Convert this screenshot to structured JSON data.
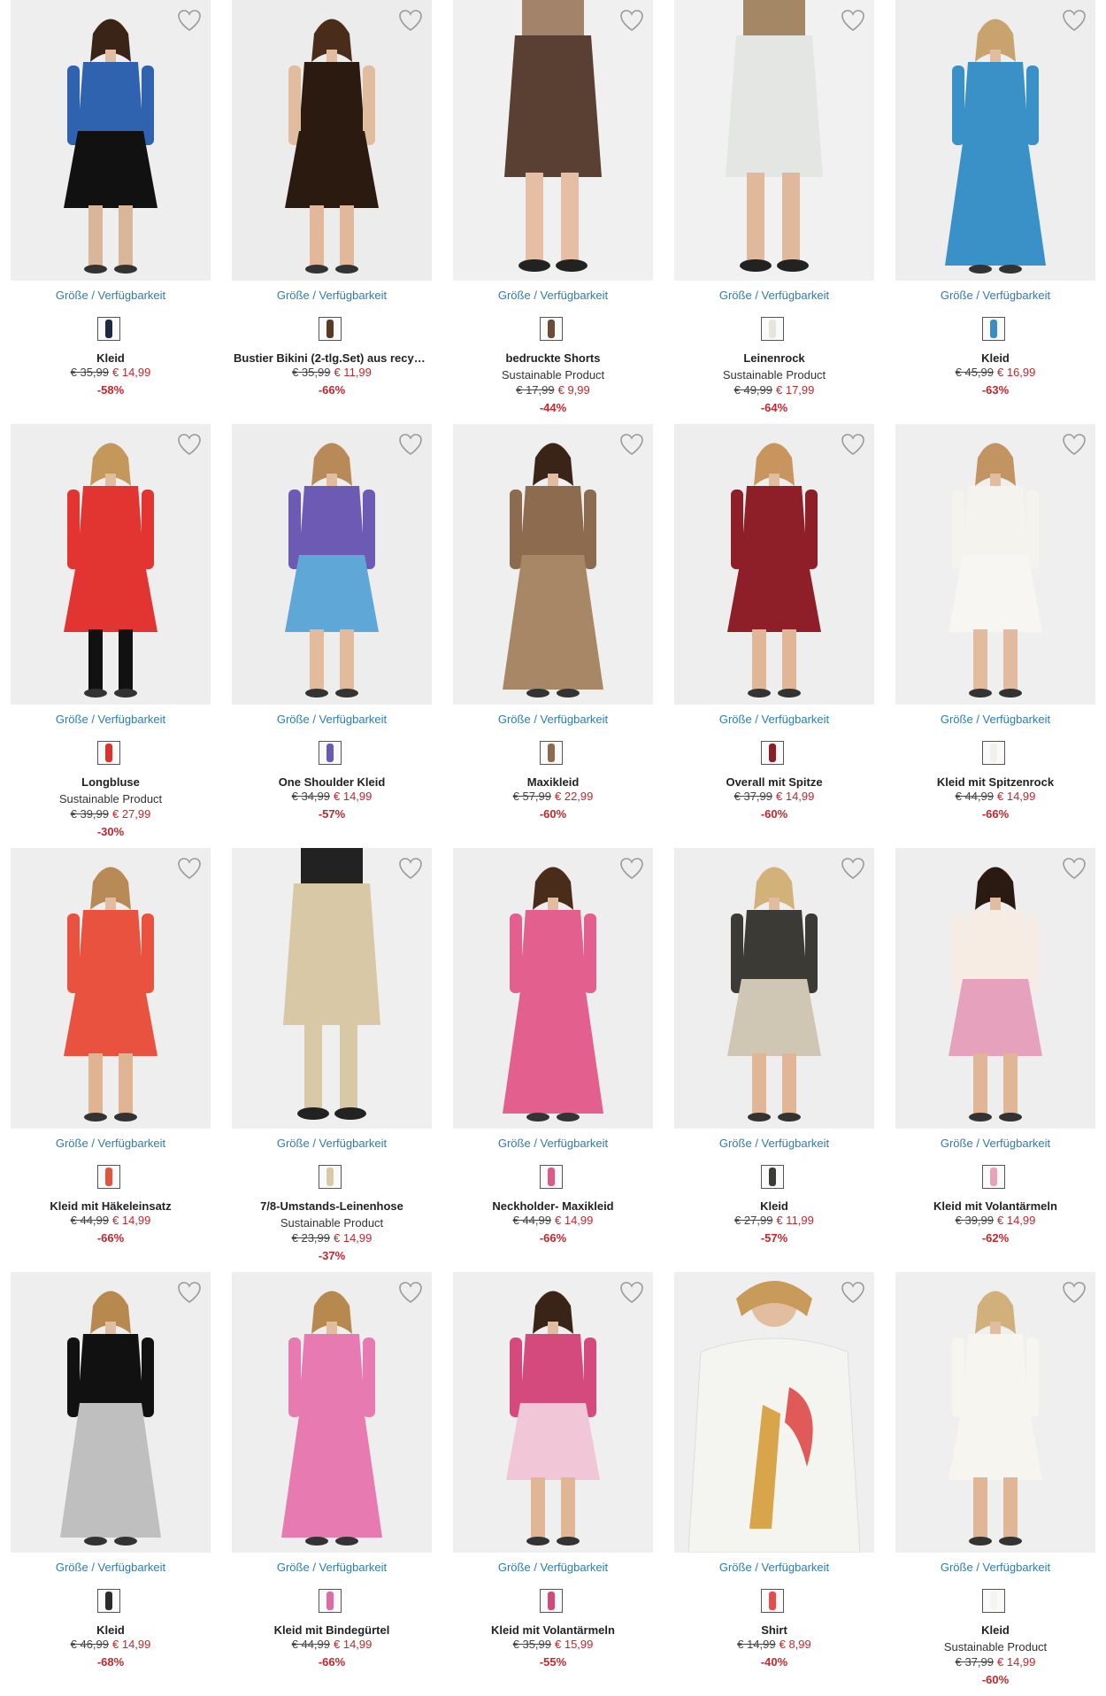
{
  "colors": {
    "accent_link": "#2b7cb3",
    "sale_red": "#c4262e",
    "text": "#222222",
    "image_bg": "#efefef"
  },
  "size_label": "Größe / Verfügbarkeit",
  "products": [
    {
      "name": "Kleid",
      "sub": "",
      "old_price": "€ 35,99",
      "new_price": "€ 14,99",
      "discount": "-58%",
      "swatch": "#1e2a44",
      "img": "dress-blue-black"
    },
    {
      "name": "Bustier Bikini (2-tlg.Set) aus recycelt...",
      "sub": "",
      "old_price": "€ 35,99",
      "new_price": "€ 11,99",
      "discount": "-66%",
      "swatch": "#5a3a22",
      "img": "bikini-floral"
    },
    {
      "name": "bedruckte Shorts",
      "sub": "Sustainable Product",
      "old_price": "€ 17,99",
      "new_price": "€ 9,99",
      "discount": "-44%",
      "swatch": "#6b4a3a",
      "img": "shorts-print"
    },
    {
      "name": "Leinenrock",
      "sub": "Sustainable Product",
      "old_price": "€ 49,99",
      "new_price": "€ 17,99",
      "discount": "-64%",
      "swatch": "#e7e4da",
      "img": "linen-skirt"
    },
    {
      "name": "Kleid",
      "sub": "",
      "old_price": "€ 45,99",
      "new_price": "€ 16,99",
      "discount": "-63%",
      "swatch": "#3b8ec4",
      "img": "dress-blue-maxi"
    },
    {
      "name": "Longbluse",
      "sub": "Sustainable Product",
      "old_price": "€ 39,99",
      "new_price": "€ 27,99",
      "discount": "-30%",
      "swatch": "#e0302c",
      "img": "red-blouse"
    },
    {
      "name": "One Shoulder Kleid",
      "sub": "",
      "old_price": "€ 34,99",
      "new_price": "€ 14,99",
      "discount": "-57%",
      "swatch": "#6a5ab8",
      "img": "one-shoulder"
    },
    {
      "name": "Maxikleid",
      "sub": "",
      "old_price": "€ 57,99",
      "new_price": "€ 22,99",
      "discount": "-60%",
      "swatch": "#8c6a4e",
      "img": "leopard-maxi"
    },
    {
      "name": "Overall mit Spitze",
      "sub": "",
      "old_price": "€ 37,99",
      "new_price": "€ 14,99",
      "discount": "-60%",
      "swatch": "#8b1e26",
      "img": "lace-overall"
    },
    {
      "name": "Kleid mit Spitzenrock",
      "sub": "",
      "old_price": "€ 44,99",
      "new_price": "€ 14,99",
      "discount": "-66%",
      "swatch": "#f2f0ea",
      "img": "white-lace"
    },
    {
      "name": "Kleid mit Häkeleinsatz",
      "sub": "",
      "old_price": "€ 44,99",
      "new_price": "€ 14,99",
      "discount": "-66%",
      "swatch": "#e4533e",
      "img": "red-floral"
    },
    {
      "name": "7/8-Umstands-Leinenhose",
      "sub": "Sustainable Product",
      "old_price": "€ 23,99",
      "new_price": "€ 14,99",
      "discount": "-37%",
      "swatch": "#d9c9a8",
      "img": "beige-pants"
    },
    {
      "name": "Neckholder- Maxikleid",
      "sub": "",
      "old_price": "€ 44,99",
      "new_price": "€ 14,99",
      "discount": "-66%",
      "swatch": "#e0588a",
      "img": "pink-maxi"
    },
    {
      "name": "Kleid",
      "sub": "",
      "old_price": "€ 27,99",
      "new_price": "€ 11,99",
      "discount": "-57%",
      "swatch": "#3a3a36",
      "img": "leaf-dress"
    },
    {
      "name": "Kleid mit Volantärmeln",
      "sub": "",
      "old_price": "€ 39,99",
      "new_price": "€ 14,99",
      "discount": "-62%",
      "swatch": "#e8a3b8",
      "img": "pastel-floral"
    },
    {
      "name": "Kleid",
      "sub": "",
      "old_price": "€ 46,99",
      "new_price": "€ 14,99",
      "discount": "-68%",
      "swatch": "#2b2b2b",
      "img": "black-leo-maxi"
    },
    {
      "name": "Kleid mit Bindegürtel",
      "sub": "",
      "old_price": "€ 44,99",
      "new_price": "€ 14,99",
      "discount": "-66%",
      "swatch": "#e06aa6",
      "img": "pink-belt"
    },
    {
      "name": "Kleid mit Volantärmeln",
      "sub": "",
      "old_price": "€ 35,99",
      "new_price": "€ 15,99",
      "discount": "-55%",
      "swatch": "#d24a7a",
      "img": "pink-kaftan"
    },
    {
      "name": "Shirt",
      "sub": "",
      "old_price": "€ 14,99",
      "new_price": "€ 8,99",
      "discount": "-40%",
      "swatch": "#e74c4c",
      "img": "giraffe-shirt"
    },
    {
      "name": "Kleid",
      "sub": "Sustainable Product",
      "old_price": "€ 37,99",
      "new_price": "€ 14,99",
      "discount": "-60%",
      "swatch": "#f5f4ef",
      "img": "white-dress"
    }
  ]
}
